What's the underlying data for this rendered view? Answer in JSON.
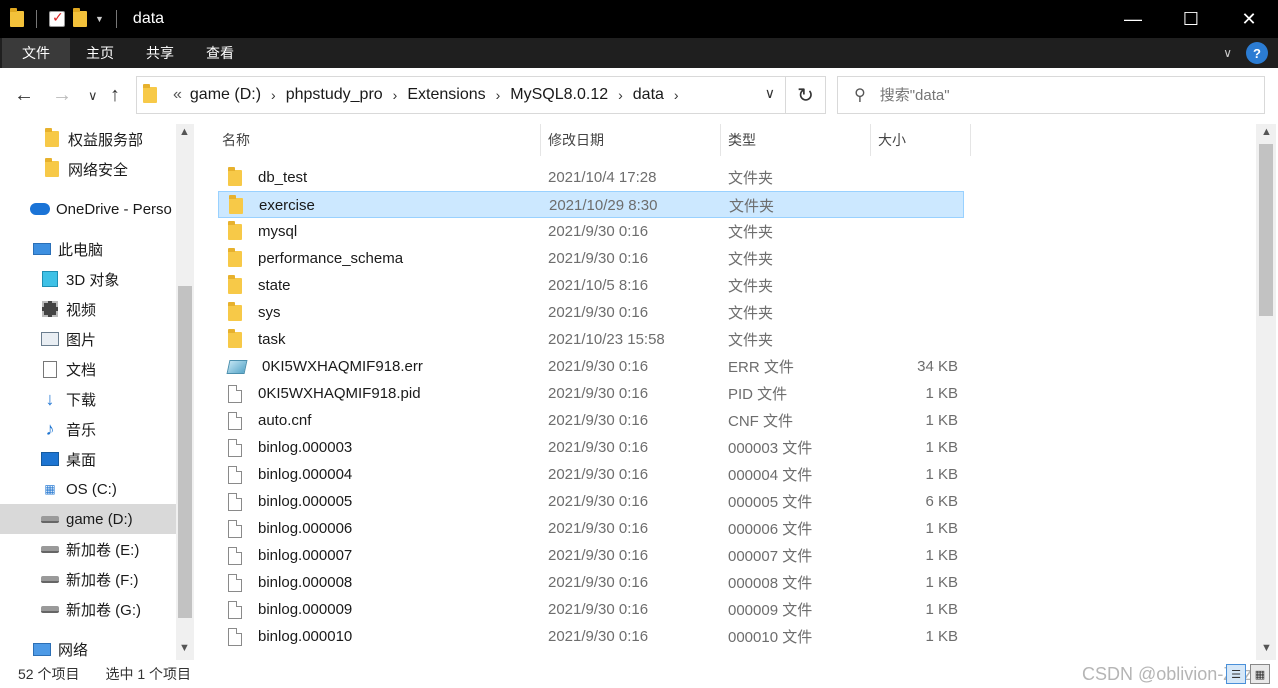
{
  "window": {
    "title": "data",
    "minimize": "—",
    "maximize": "☐",
    "close": "✕"
  },
  "ribbon": {
    "tabs": [
      "文件",
      "主页",
      "共享",
      "查看"
    ],
    "collapse": "∨",
    "help": "?"
  },
  "nav": {
    "back": "←",
    "forward": "→",
    "recent": "∨",
    "up": "↑",
    "overflow": "«",
    "breadcrumbs": [
      "game (D:)",
      "phpstudy_pro",
      "Extensions",
      "MySQL8.0.12",
      "data"
    ],
    "crumb_sep": "›",
    "dropdown": "∨",
    "refresh": "↻",
    "search_placeholder": "搜索\"data\"",
    "search_icon": "search-icon"
  },
  "sidebar": {
    "items": [
      {
        "label": "权益服务部",
        "icon": "folder-icon"
      },
      {
        "label": "网络安全",
        "icon": "folder-icon"
      },
      {
        "label": "OneDrive - Perso",
        "icon": "cloud-icon"
      },
      {
        "label": "此电脑",
        "icon": "computer-icon"
      },
      {
        "label": "3D 对象",
        "icon": "3d-objects-icon"
      },
      {
        "label": "视频",
        "icon": "video-icon"
      },
      {
        "label": "图片",
        "icon": "pictures-icon"
      },
      {
        "label": "文档",
        "icon": "documents-icon"
      },
      {
        "label": "下载",
        "icon": "download-icon"
      },
      {
        "label": "音乐",
        "icon": "music-icon"
      },
      {
        "label": "桌面",
        "icon": "desktop-icon"
      },
      {
        "label": "OS (C:)",
        "icon": "windows-drive-icon"
      },
      {
        "label": "game (D:)",
        "icon": "drive-icon",
        "selected": true
      },
      {
        "label": "新加卷 (E:)",
        "icon": "drive-icon"
      },
      {
        "label": "新加卷 (F:)",
        "icon": "drive-icon"
      },
      {
        "label": "新加卷 (G:)",
        "icon": "drive-icon"
      },
      {
        "label": "网络",
        "icon": "network-icon"
      }
    ]
  },
  "columns": {
    "name": "名称",
    "date": "修改日期",
    "type": "类型",
    "size": "大小"
  },
  "files": [
    {
      "name": "db_test",
      "date": "2021/10/4 17:28",
      "type": "文件夹",
      "size": "",
      "icon": "folder-icon"
    },
    {
      "name": "exercise",
      "date": "2021/10/29 8:30",
      "type": "文件夹",
      "size": "",
      "icon": "folder-icon",
      "selected": true
    },
    {
      "name": "mysql",
      "date": "2021/9/30 0:16",
      "type": "文件夹",
      "size": "",
      "icon": "folder-icon"
    },
    {
      "name": "performance_schema",
      "date": "2021/9/30 0:16",
      "type": "文件夹",
      "size": "",
      "icon": "folder-icon"
    },
    {
      "name": "state",
      "date": "2021/10/5 8:16",
      "type": "文件夹",
      "size": "",
      "icon": "folder-icon"
    },
    {
      "name": "sys",
      "date": "2021/9/30 0:16",
      "type": "文件夹",
      "size": "",
      "icon": "folder-icon"
    },
    {
      "name": "task",
      "date": "2021/10/23 15:58",
      "type": "文件夹",
      "size": "",
      "icon": "folder-icon"
    },
    {
      "name": "0KI5WXHAQMIF918.err",
      "date": "2021/9/30 0:16",
      "type": "ERR 文件",
      "size": "34 KB",
      "icon": "err-file-icon"
    },
    {
      "name": "0KI5WXHAQMIF918.pid",
      "date": "2021/9/30 0:16",
      "type": "PID 文件",
      "size": "1 KB",
      "icon": "file-icon"
    },
    {
      "name": "auto.cnf",
      "date": "2021/9/30 0:16",
      "type": "CNF 文件",
      "size": "1 KB",
      "icon": "file-icon"
    },
    {
      "name": "binlog.000003",
      "date": "2021/9/30 0:16",
      "type": "000003 文件",
      "size": "1 KB",
      "icon": "file-icon"
    },
    {
      "name": "binlog.000004",
      "date": "2021/9/30 0:16",
      "type": "000004 文件",
      "size": "1 KB",
      "icon": "file-icon"
    },
    {
      "name": "binlog.000005",
      "date": "2021/9/30 0:16",
      "type": "000005 文件",
      "size": "6 KB",
      "icon": "file-icon"
    },
    {
      "name": "binlog.000006",
      "date": "2021/9/30 0:16",
      "type": "000006 文件",
      "size": "1 KB",
      "icon": "file-icon"
    },
    {
      "name": "binlog.000007",
      "date": "2021/9/30 0:16",
      "type": "000007 文件",
      "size": "1 KB",
      "icon": "file-icon"
    },
    {
      "name": "binlog.000008",
      "date": "2021/9/30 0:16",
      "type": "000008 文件",
      "size": "1 KB",
      "icon": "file-icon"
    },
    {
      "name": "binlog.000009",
      "date": "2021/9/30 0:16",
      "type": "000009 文件",
      "size": "1 KB",
      "icon": "file-icon"
    },
    {
      "name": "binlog.000010",
      "date": "2021/9/30 0:16",
      "type": "000010 文件",
      "size": "1 KB",
      "icon": "file-icon"
    }
  ],
  "status": {
    "count": "52 个项目",
    "selection": "选中 1 个项目",
    "watermark": "CSDN @oblivion-Zzz"
  },
  "colors": {
    "titlebar": "#000000",
    "ribbon": "#1f1f1f",
    "selection": "#cce8ff",
    "selection_border": "#99d1ff",
    "folder": "#f7c948",
    "accent": "#2b7cd3"
  }
}
